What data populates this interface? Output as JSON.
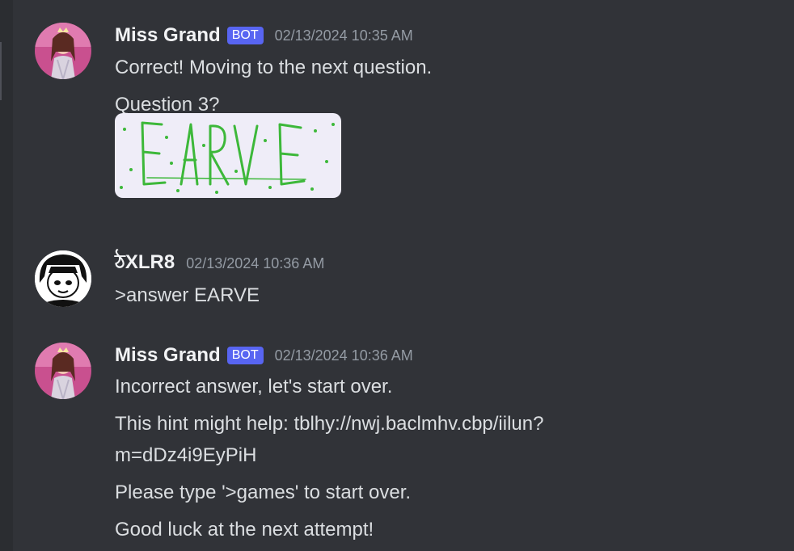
{
  "messages": [
    {
      "author": "Miss Grand",
      "badge": "BOT",
      "timestamp": "02/13/2024 10:35 AM",
      "lines": [
        "Correct! Moving to the next question.",
        "Question 3?"
      ],
      "captcha_text": "EARVE"
    },
    {
      "author": "ঠXLR8",
      "timestamp": "02/13/2024 10:36 AM",
      "lines": [
        ">answer EARVE"
      ]
    },
    {
      "author": "Miss Grand",
      "badge": "BOT",
      "timestamp": "02/13/2024 10:36 AM",
      "lines": [
        "Incorrect answer, let's start over.",
        "This hint might help: tblhy://nwj.baclmhv.cbp/iilun?",
        "m=dDz4i9EyPiH",
        "Please type '>games' to start over.",
        "Good luck at the next attempt!"
      ]
    }
  ],
  "colors": {
    "background": "#313338",
    "bot_badge": "#5865f2",
    "captcha_ink": "#3db83a"
  },
  "icons": [
    "bot-avatar-icon",
    "user-avatar-icon"
  ]
}
